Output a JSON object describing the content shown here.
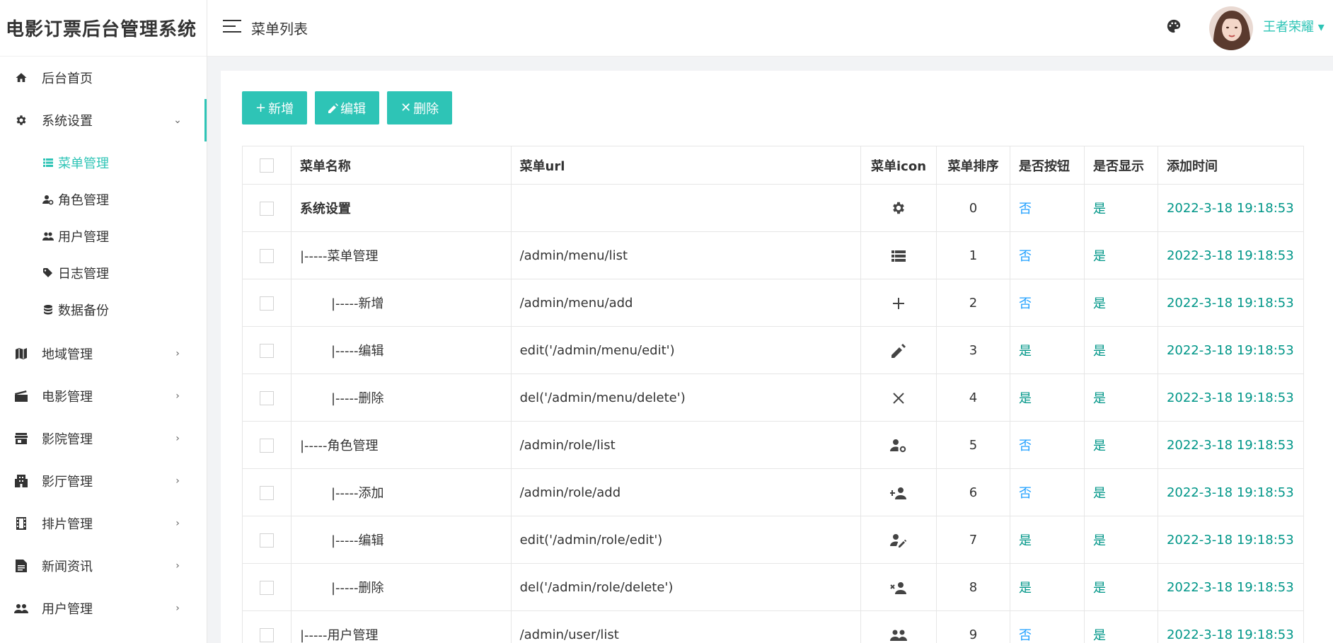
{
  "app": {
    "title": "电影订票后台管理系统"
  },
  "header": {
    "page_title": "菜单列表",
    "username": "王者荣耀 ▾"
  },
  "sidebar": {
    "items": [
      {
        "label": "后台首页",
        "icon": "home-icon"
      },
      {
        "label": "系统设置",
        "icon": "gear-icon",
        "chevron": "⌄"
      },
      {
        "label": "地域管理",
        "icon": "map-icon",
        "chevron": "›"
      },
      {
        "label": "电影管理",
        "icon": "film-icon",
        "chevron": "›"
      },
      {
        "label": "影院管理",
        "icon": "store-icon",
        "chevron": "›"
      },
      {
        "label": "影厅管理",
        "icon": "building-icon",
        "chevron": "›"
      },
      {
        "label": "排片管理",
        "icon": "filmstrip-icon",
        "chevron": "›"
      },
      {
        "label": "新闻资讯",
        "icon": "document-icon",
        "chevron": "›"
      },
      {
        "label": "用户管理",
        "icon": "users-icon",
        "chevron": "›"
      }
    ],
    "subitems": [
      {
        "label": "菜单管理",
        "icon": "list-icon"
      },
      {
        "label": "角色管理",
        "icon": "user-gear-icon"
      },
      {
        "label": "用户管理",
        "icon": "users-icon"
      },
      {
        "label": "日志管理",
        "icon": "tag-icon"
      },
      {
        "label": "数据备份",
        "icon": "database-icon"
      }
    ]
  },
  "toolbar": {
    "add_label": "新增",
    "edit_label": "编辑",
    "delete_label": "删除"
  },
  "table": {
    "headers": [
      "菜单名称",
      "菜单url",
      "菜单icon",
      "菜单排序",
      "是否按钮",
      "是否显示",
      "添加时间"
    ],
    "rows": [
      {
        "name": "系统设置",
        "url": "",
        "icon": "gear-icon",
        "order": "0",
        "is_button": "否",
        "is_show": "是",
        "time": "2022-3-18 19:18:53"
      },
      {
        "name": "|-----菜单管理",
        "url": "/admin/menu/list",
        "icon": "list-icon",
        "order": "1",
        "is_button": "否",
        "is_show": "是",
        "time": "2022-3-18 19:18:53"
      },
      {
        "name": "|-----新增",
        "url": "/admin/menu/add",
        "icon": "plus-icon",
        "order": "2",
        "is_button": "否",
        "is_show": "是",
        "time": "2022-3-18 19:18:53"
      },
      {
        "name": "|-----编辑",
        "url": "edit('/admin/menu/edit')",
        "icon": "pencil-icon",
        "order": "3",
        "is_button": "是",
        "is_show": "是",
        "time": "2022-3-18 19:18:53"
      },
      {
        "name": "|-----删除",
        "url": "del('/admin/menu/delete')",
        "icon": "close-icon",
        "order": "4",
        "is_button": "是",
        "is_show": "是",
        "time": "2022-3-18 19:18:53"
      },
      {
        "name": "|-----角色管理",
        "url": "/admin/role/list",
        "icon": "user-gear-icon",
        "order": "5",
        "is_button": "否",
        "is_show": "是",
        "time": "2022-3-18 19:18:53"
      },
      {
        "name": "|-----添加",
        "url": "/admin/role/add",
        "icon": "user-add-icon",
        "order": "6",
        "is_button": "否",
        "is_show": "是",
        "time": "2022-3-18 19:18:53"
      },
      {
        "name": "|-----编辑",
        "url": "edit('/admin/role/edit')",
        "icon": "user-edit-icon",
        "order": "7",
        "is_button": "是",
        "is_show": "是",
        "time": "2022-3-18 19:18:53"
      },
      {
        "name": "|-----删除",
        "url": "del('/admin/role/delete')",
        "icon": "user-remove-icon",
        "order": "8",
        "is_button": "是",
        "is_show": "是",
        "time": "2022-3-18 19:18:53"
      },
      {
        "name": "|-----用户管理",
        "url": "/admin/user/list",
        "icon": "users-icon",
        "order": "9",
        "is_button": "否",
        "is_show": "是",
        "time": "2022-3-18 19:18:53"
      }
    ]
  },
  "colors": {
    "accent": "#2ec4b6",
    "link_blue": "#1e9fff",
    "green": "#009688"
  }
}
